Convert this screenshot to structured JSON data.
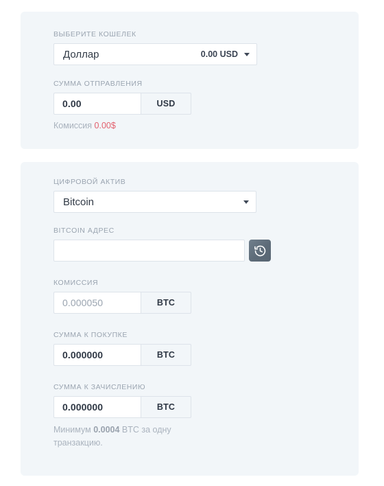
{
  "send_card": {
    "wallet": {
      "label": "ВЫБЕРИТЕ КОШЕЛЕК",
      "selected_name": "Доллар",
      "selected_balance": "0.00 USD",
      "caret_icon": "chevron-down-icon"
    },
    "amount": {
      "label": "СУММА ОТПРАВЛЕНИЯ",
      "value": "0.00",
      "currency": "USD"
    },
    "fee_note": {
      "prefix": "Комиссия",
      "value": "0.00$"
    }
  },
  "asset_card": {
    "asset": {
      "label": "ЦИФРОВОЙ АКТИВ",
      "selected_name": "Bitcoin",
      "caret_icon": "chevron-down-icon"
    },
    "address": {
      "label": "BITCOIN АДРЕС",
      "value": "",
      "placeholder": "",
      "history_button_icon": "history-clock-icon"
    },
    "commission": {
      "label": "КОМИССИЯ",
      "value": "0.000050",
      "currency": "BTC"
    },
    "purchase_amount": {
      "label": "СУММА К ПОКУПКЕ",
      "value": "0.000000",
      "currency": "BTC"
    },
    "credited_amount": {
      "label": "СУММА К ЗАЧИСЛЕНИЮ",
      "value": "0.000000",
      "currency": "BTC"
    },
    "minimum_hint": {
      "prefix": "Минимум",
      "value": "0.0004",
      "suffix": "BTC за одну транзакцию."
    }
  },
  "colors": {
    "card_background": "#f2f6f9",
    "page_background": "#ffffff",
    "label_text": "#9aa4b0",
    "value_text": "#2f3845",
    "accent_red": "#e2616e",
    "history_button": "#5d6b78",
    "border": "#dde3ea"
  }
}
